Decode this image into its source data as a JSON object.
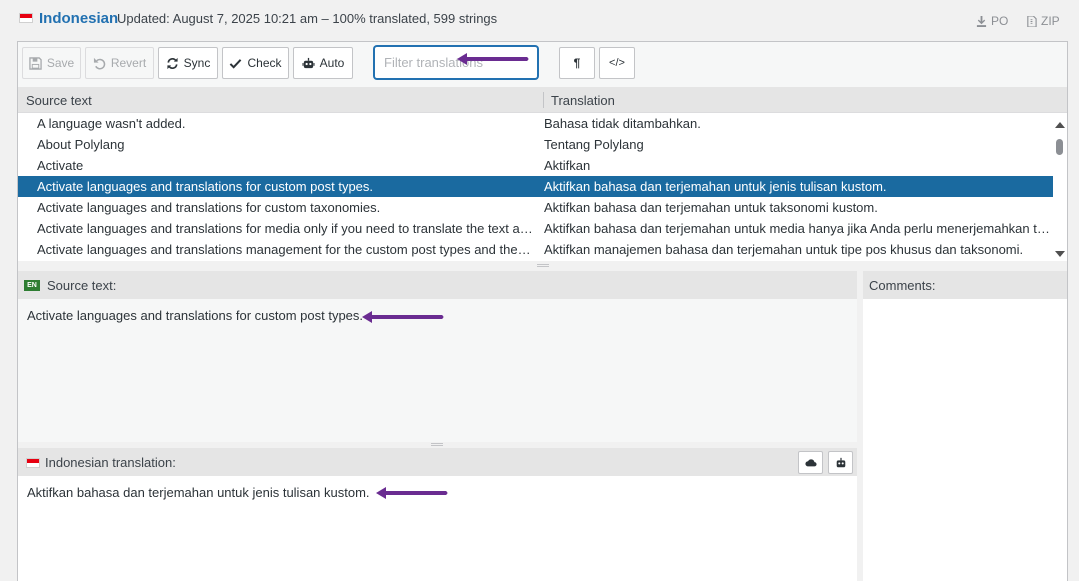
{
  "header": {
    "language": "Indonesian",
    "updated": "Updated: August 7, 2025 10:21 am – 100% translated, 599 strings",
    "download_po": "PO",
    "download_zip": "ZIP"
  },
  "toolbar": {
    "save": "Save",
    "revert": "Revert",
    "sync": "Sync",
    "check": "Check",
    "auto": "Auto",
    "filter_placeholder": "Filter translations",
    "pilcrow": "¶",
    "code": "</>"
  },
  "list": {
    "source_header": "Source text",
    "translation_header": "Translation",
    "rows": [
      {
        "source": "A language wasn't added.",
        "translation": "Bahasa tidak ditambahkan."
      },
      {
        "source": "About Polylang",
        "translation": "Tentang Polylang"
      },
      {
        "source": "Activate",
        "translation": "Aktifkan"
      },
      {
        "source": "Activate languages and translations for custom post types.",
        "translation": "Aktifkan bahasa dan terjemahan untuk jenis tulisan kustom."
      },
      {
        "source": "Activate languages and translations for custom taxonomies.",
        "translation": "Aktifkan bahasa dan terjemahan untuk taksonomi kustom."
      },
      {
        "source": "Activate languages and translations for media only if you need to translate the text attached to the media",
        "translation": "Aktifkan bahasa dan terjemahan untuk media hanya jika Anda perlu menerjemahkan teks yang"
      },
      {
        "source": "Activate languages and translations management for the custom post types and the taxonomies.",
        "translation": "Aktifkan manajemen bahasa dan terjemahan untuk tipe pos khusus dan taksonomi."
      }
    ],
    "selected_index": 3
  },
  "source_pane": {
    "badge": "EN",
    "label": "Source text:",
    "text": "Activate languages and translations for custom post types."
  },
  "translation_pane": {
    "label": "Indonesian translation:",
    "text": "Aktifkan bahasa dan terjemahan untuk jenis tulisan kustom."
  },
  "comments_pane": {
    "label": "Comments:"
  },
  "colors": {
    "accent": "#2271b1",
    "selected_row": "#1a6aa0",
    "annotation_arrow": "#6a2c91"
  },
  "icons": [
    "floppy-icon",
    "undo-icon",
    "sync-icon",
    "check-icon",
    "robot-icon",
    "pilcrow-icon",
    "code-icon",
    "download-icon",
    "file-icon",
    "cloud-icon",
    "flag-icon"
  ]
}
